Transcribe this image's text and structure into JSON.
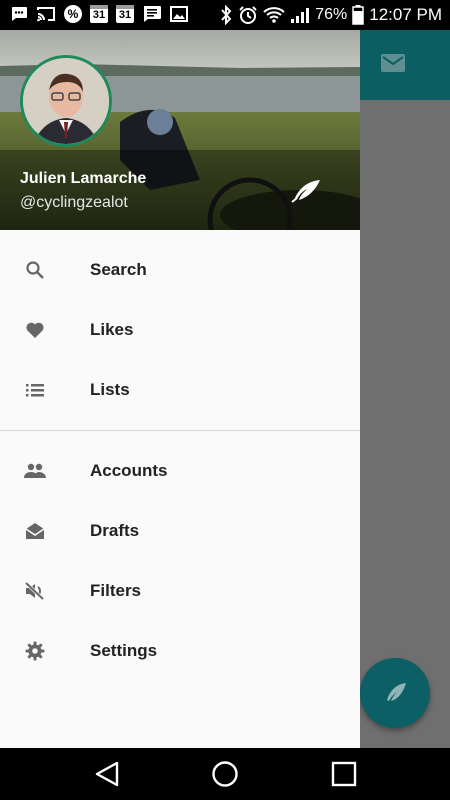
{
  "status_bar": {
    "notification_icons": [
      "chat-icon",
      "cast-icon",
      "percent-badge-icon",
      "calendar-icon",
      "calendar-icon",
      "message-icon",
      "image-icon"
    ],
    "percent_badge": "%",
    "calendar_day_1": "31",
    "calendar_day_2": "31",
    "system_icons": [
      "bluetooth-icon",
      "alarm-icon",
      "wifi-icon",
      "signal-icon",
      "battery-icon"
    ],
    "battery_level": "76%",
    "time": "12:07 PM"
  },
  "drawer": {
    "user": {
      "name": "Julien Lamarche",
      "handle": "@cyclingzealot"
    },
    "menu_primary": [
      {
        "label": "Search",
        "icon": "search-icon"
      },
      {
        "label": "Likes",
        "icon": "heart-icon"
      },
      {
        "label": "Lists",
        "icon": "list-icon"
      }
    ],
    "menu_secondary": [
      {
        "label": "Accounts",
        "icon": "people-icon"
      },
      {
        "label": "Drafts",
        "icon": "drafts-icon"
      },
      {
        "label": "Filters",
        "icon": "mute-icon"
      },
      {
        "label": "Settings",
        "icon": "gear-icon"
      }
    ]
  },
  "background_app": {
    "toolbar_icon": "mail-icon",
    "fab_icon": "quill-icon"
  },
  "nav_bar": {
    "buttons": [
      "back-icon",
      "home-icon",
      "recents-icon"
    ]
  },
  "colors": {
    "accent": "#0b5f63",
    "drawer_bg": "#fafafa",
    "avatar_ring": "#1e8a5a"
  }
}
